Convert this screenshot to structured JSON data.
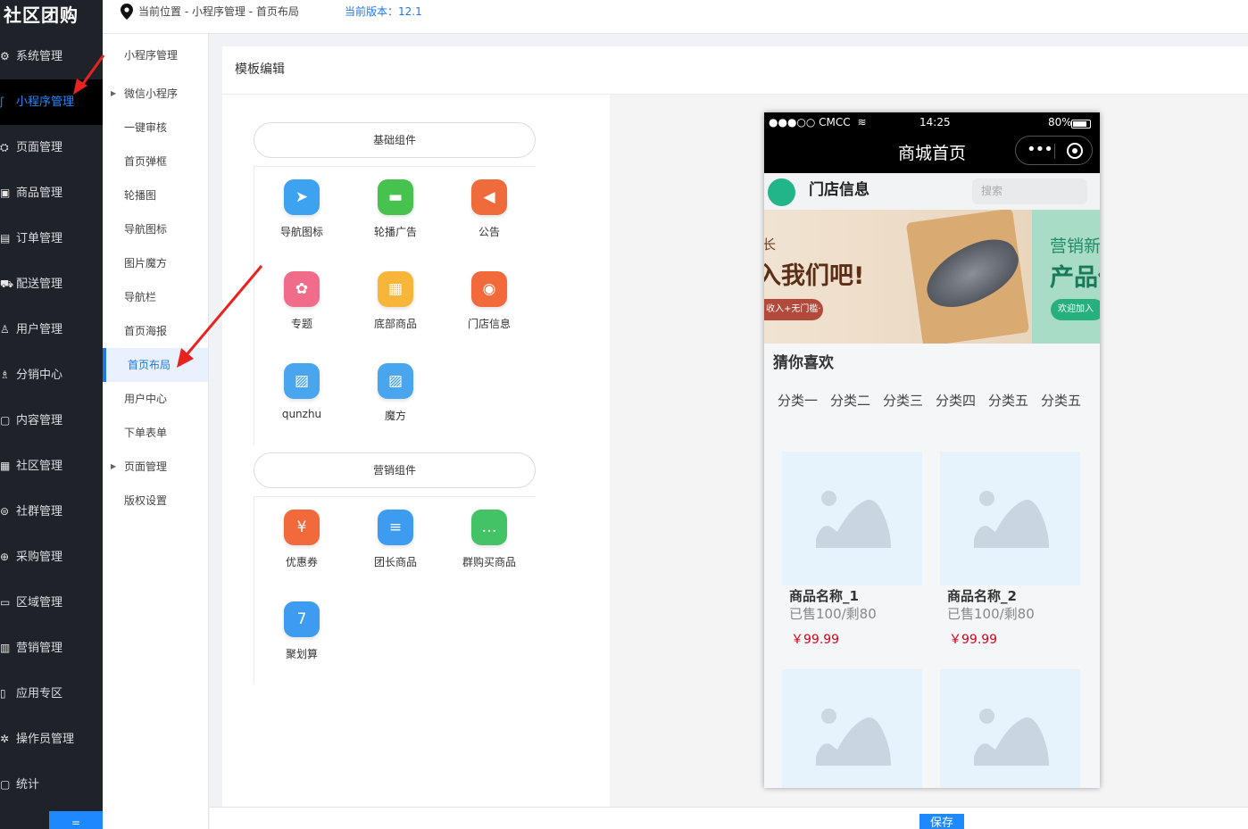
{
  "brand": "社区团购",
  "topbar": {
    "location": "当前位置 - 小程序管理 - 首页布局",
    "version": "当前版本：12.1"
  },
  "nav": [
    {
      "label": "系统管理",
      "icon": "gear-icon",
      "glyph": "⚙"
    },
    {
      "label": "小程序管理",
      "icon": "miniprogram-icon",
      "glyph": "ʃ",
      "active": true
    },
    {
      "label": "页面管理",
      "icon": "page-icon",
      "glyph": "⛭"
    },
    {
      "label": "商品管理",
      "icon": "goods-icon",
      "glyph": "▣"
    },
    {
      "label": "订单管理",
      "icon": "order-icon",
      "glyph": "▤"
    },
    {
      "label": "配送管理",
      "icon": "delivery-icon",
      "glyph": "⛟"
    },
    {
      "label": "用户管理",
      "icon": "user-icon",
      "glyph": "♙"
    },
    {
      "label": "分销中心",
      "icon": "distribution-icon",
      "glyph": "♗"
    },
    {
      "label": "内容管理",
      "icon": "content-icon",
      "glyph": "▢"
    },
    {
      "label": "社区管理",
      "icon": "community-icon",
      "glyph": "▦"
    },
    {
      "label": "社群管理",
      "icon": "group-icon",
      "glyph": "⊜"
    },
    {
      "label": "采购管理",
      "icon": "purchase-icon",
      "glyph": "⊕"
    },
    {
      "label": "区域管理",
      "icon": "region-icon",
      "glyph": "▭"
    },
    {
      "label": "营销管理",
      "icon": "marketing-icon",
      "glyph": "▥"
    },
    {
      "label": "应用专区",
      "icon": "apps-icon",
      "glyph": "▯"
    },
    {
      "label": "操作员管理",
      "icon": "operator-icon",
      "glyph": "✲"
    },
    {
      "label": "统计",
      "icon": "stats-icon",
      "glyph": "▢"
    }
  ],
  "nav_bottom_label": "=",
  "subnav": [
    {
      "label": "小程序管理"
    },
    {
      "label": "微信小程序",
      "expandable": true
    },
    {
      "label": "一键审核"
    },
    {
      "label": "首页弹框"
    },
    {
      "label": "轮播图"
    },
    {
      "label": "导航图标"
    },
    {
      "label": "图片魔方"
    },
    {
      "label": "导航栏"
    },
    {
      "label": "首页海报"
    },
    {
      "label": "首页布局",
      "active": true
    },
    {
      "label": "用户中心"
    },
    {
      "label": "下单表单"
    },
    {
      "label": "页面管理",
      "expandable": true
    },
    {
      "label": "版权设置"
    }
  ],
  "main": {
    "title": "模板编辑",
    "basic_group": "基础组件",
    "marketing_group": "营销组件",
    "basic_items": [
      {
        "label": "导航图标",
        "icon": "navigation-icon",
        "color": "#3da2f0",
        "glyph": "➤"
      },
      {
        "label": "轮播广告",
        "icon": "carousel-icon",
        "color": "#47c24e",
        "glyph": "▬"
      },
      {
        "label": "公告",
        "icon": "announcement-icon",
        "color": "#f06b3b",
        "glyph": "◀"
      },
      {
        "label": "专题",
        "icon": "topic-icon",
        "color": "#f16b8a",
        "glyph": "✿"
      },
      {
        "label": "底部商品",
        "icon": "bottom-goods-icon",
        "color": "#f7b63a",
        "glyph": "▦"
      },
      {
        "label": "门店信息",
        "icon": "store-info-icon",
        "color": "#f26a3c",
        "glyph": "◉"
      },
      {
        "label": "qunzhu",
        "icon": "image-icon",
        "color": "#4aa5ef",
        "glyph": "▨"
      },
      {
        "label": "魔方",
        "icon": "cube-image-icon",
        "color": "#4aa5ef",
        "glyph": "▨"
      }
    ],
    "marketing_items": [
      {
        "label": "优惠券",
        "icon": "coupon-icon",
        "color": "#f26a3c",
        "glyph": "¥"
      },
      {
        "label": "团长商品",
        "icon": "leader-goods-icon",
        "color": "#3d9cef",
        "glyph": "≡"
      },
      {
        "label": "群购买商品",
        "icon": "group-buy-icon",
        "color": "#43c266",
        "glyph": "…"
      },
      {
        "label": "聚划算",
        "icon": "calendar-icon",
        "color": "#3d9cef",
        "glyph": "7"
      }
    ]
  },
  "phone": {
    "carrier": "●●●○○ CMCC",
    "time": "14:25",
    "battery": "80%",
    "title": "商城首页",
    "store_name": "门店信息",
    "search_placeholder": "搜索",
    "banner_left_line1": "长",
    "banner_left_line2": "入我们吧!",
    "banner_left_pill": "收入+无门槛·",
    "banner_right_line1": "营销新店",
    "banner_right_line2": "产品供",
    "banner_right_pill": "欢迎加入",
    "guess_title": "猜你喜欢",
    "categories": [
      "分类一",
      "分类二",
      "分类三",
      "分类四",
      "分类五",
      "分类五"
    ],
    "products": [
      {
        "name": "商品名称_1",
        "sold": "已售100/剩80",
        "price": "￥99.99"
      },
      {
        "name": "商品名称_2",
        "sold": "已售100/剩80",
        "price": "￥99.99"
      },
      {
        "name": "",
        "sold": "",
        "price": ""
      },
      {
        "name": "",
        "sold": "",
        "price": ""
      }
    ]
  },
  "save_label": "保存"
}
